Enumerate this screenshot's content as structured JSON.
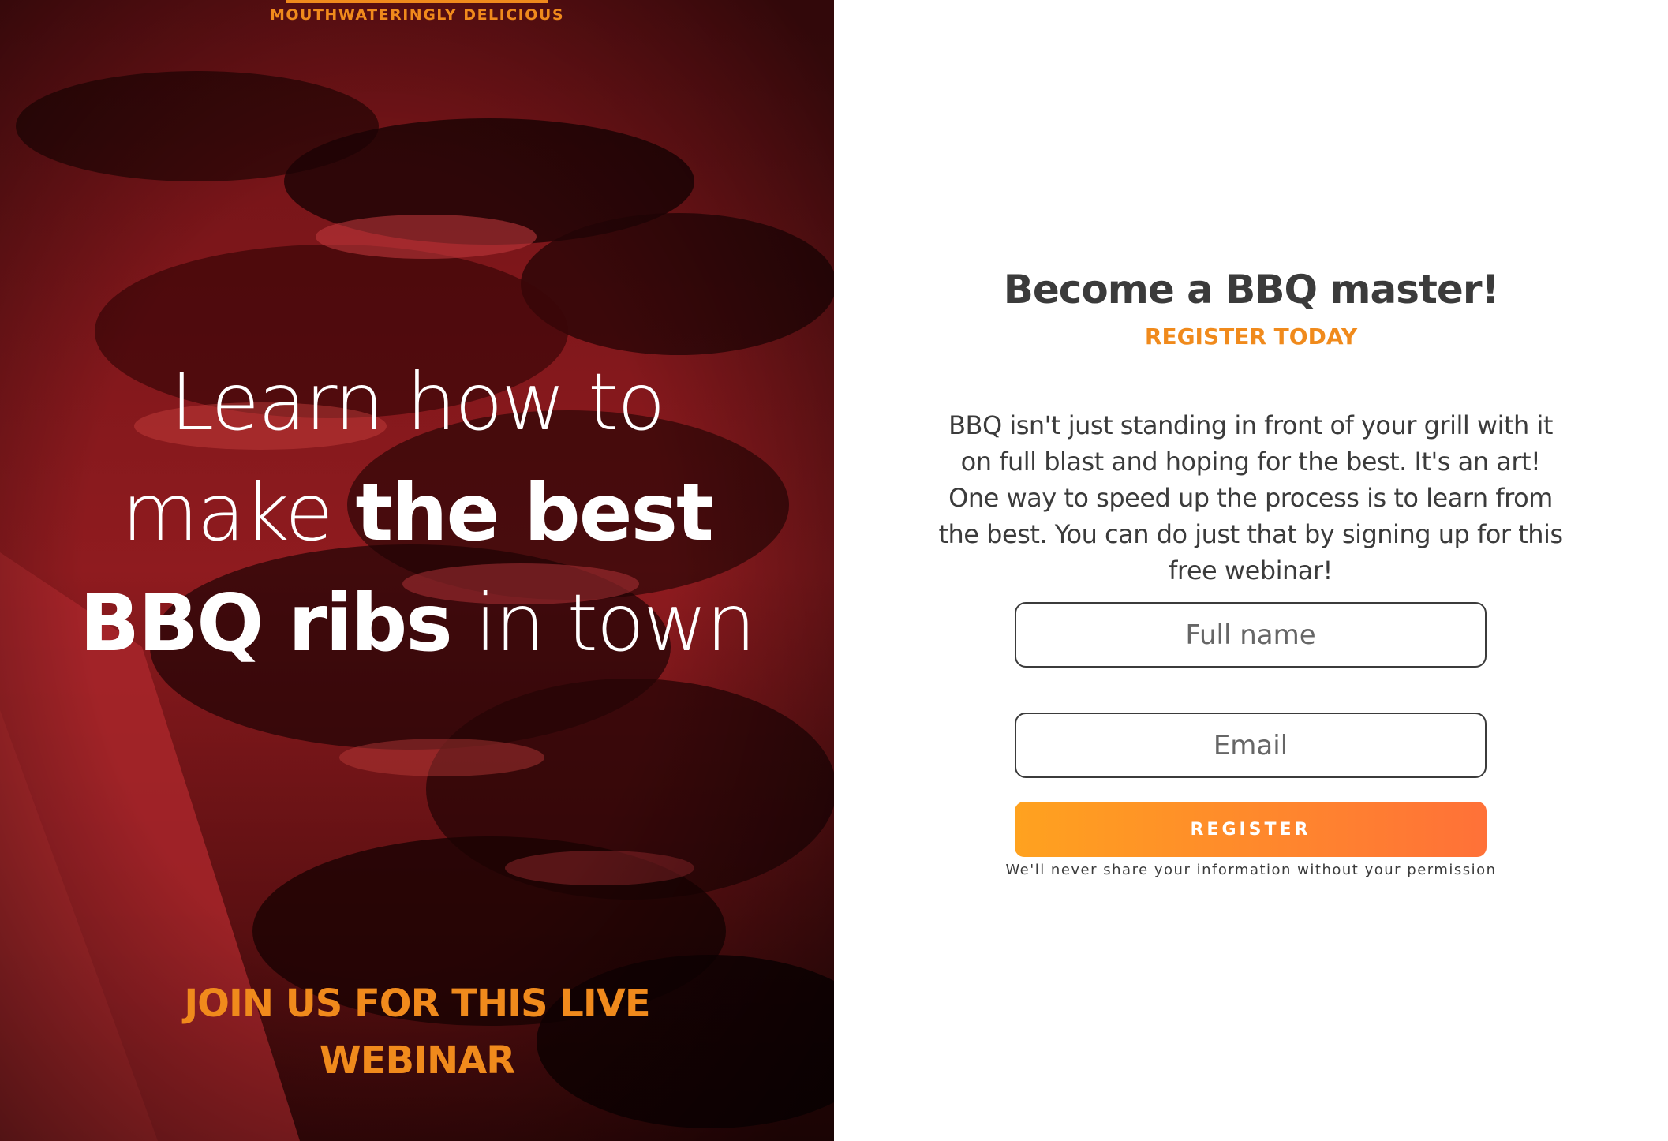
{
  "hero": {
    "brand_tagline": "MOUTHWATERINGLY DELICIOUS",
    "headline": {
      "line1": "Learn how to",
      "line2_light": "make ",
      "line2_bold": "the best",
      "line3_bold": "BBQ ribs",
      "line3_light": " in town"
    },
    "cta_line1": "JOIN US FOR THIS LIVE",
    "cta_line2": "WEBINAR",
    "image": "bbq-ribs-red-tinted-photo"
  },
  "form_panel": {
    "title": "Become a BBQ master!",
    "subtitle": "REGISTER TODAY",
    "description": "BBQ isn't just standing in front of your grill with it on full blast and hoping for the best. It's an art! One way to speed up the process is to learn from the best. You can do just that by signing up for this free webinar!",
    "full_name_placeholder": "Full name",
    "full_name_value": "",
    "email_placeholder": "Email",
    "email_value": "",
    "register_label": "REGISTER",
    "privacy_note": "We'll never share your information without your permission"
  },
  "colors": {
    "accent_orange": "#f08a1c",
    "button_gradient_start": "#ffa21f",
    "button_gradient_end": "#ff7138",
    "hero_tint": "#8b1a1e",
    "text_dark": "#3b3b3b"
  }
}
